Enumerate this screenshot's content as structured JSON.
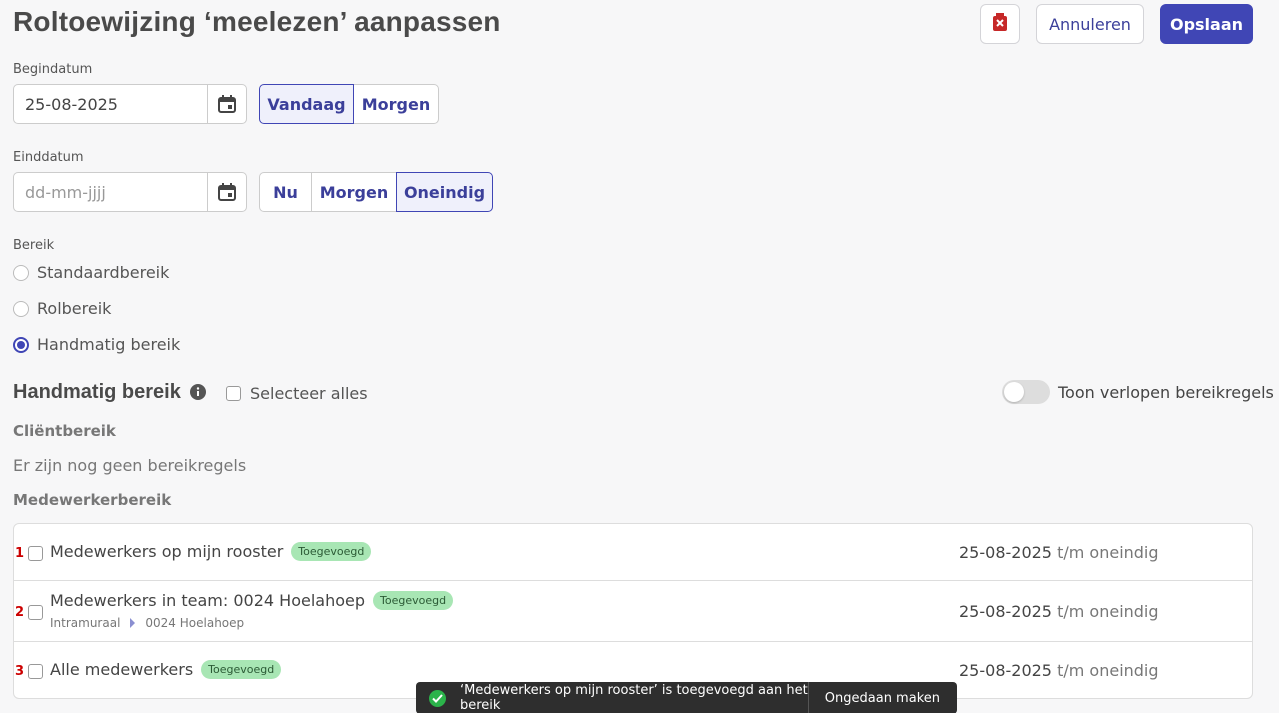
{
  "header": {
    "title": "Roltoewijzing ‘meelezen’ aanpassen",
    "delete_icon": "delete-icon",
    "cancel_label": "Annuleren",
    "save_label": "Opslaan"
  },
  "begindatum": {
    "label": "Begindatum",
    "value": "25-08-2025",
    "options": [
      "Vandaag",
      "Morgen"
    ],
    "selected": "Vandaag"
  },
  "einddatum": {
    "label": "Einddatum",
    "placeholder": "dd-mm-jjjj",
    "options": [
      "Nu",
      "Morgen",
      "Oneindig"
    ],
    "selected": "Oneindig"
  },
  "bereik": {
    "label": "Bereik",
    "options": [
      "Standaardbereik",
      "Rolbereik",
      "Handmatig bereik"
    ],
    "selected": "Handmatig bereik"
  },
  "handmatig": {
    "title": "Handmatig bereik",
    "select_all_label": "Selecteer alles",
    "toggle_label": "Toon verlopen bereikregels",
    "toggle_on": false
  },
  "clientbereik": {
    "title": "Cliëntbereik",
    "empty_text": "Er zijn nog geen bereikregels"
  },
  "medewerkerbereik": {
    "title": "Medewerkerbereik",
    "rows": [
      {
        "num": "1",
        "name": "Medewerkers op mijn rooster",
        "badge": "Toegevoegd",
        "crumb": null,
        "start": "25-08-2025",
        "end": "t/m oneindig"
      },
      {
        "num": "2",
        "name": "Medewerkers in team: 0024 Hoelahoep",
        "badge": "Toegevoegd",
        "crumb": [
          "Intramuraal",
          "0024 Hoelahoep"
        ],
        "start": "25-08-2025",
        "end": "t/m oneindig"
      },
      {
        "num": "3",
        "name": "Alle medewerkers",
        "badge": "Toegevoegd",
        "crumb": null,
        "start": "25-08-2025",
        "end": "t/m oneindig"
      }
    ]
  },
  "toast": {
    "message": "‘Medewerkers op mijn rooster’ is toegevoegd aan het bereik",
    "undo_label": "Ongedaan maken"
  },
  "colors": {
    "accent": "#4046b5",
    "badge_bg": "#a8e6b4",
    "delete_red": "#c62828",
    "toast_bg": "#2e2e2e",
    "success": "#2bb34a"
  }
}
